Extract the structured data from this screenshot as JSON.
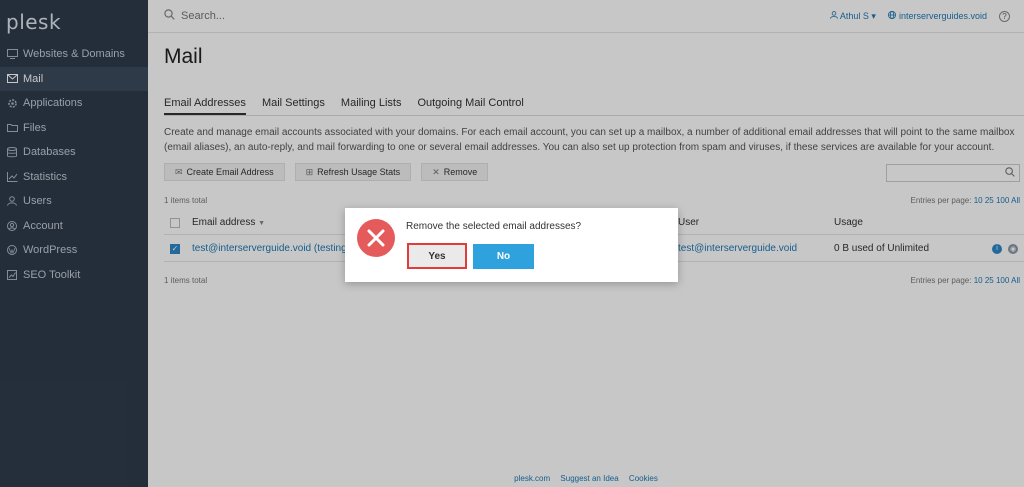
{
  "sidebar": {
    "logo": "plesk",
    "items": [
      {
        "label": "Websites & Domains",
        "icon": "monitor-icon"
      },
      {
        "label": "Mail",
        "icon": "mail-icon"
      },
      {
        "label": "Applications",
        "icon": "gear-icon"
      },
      {
        "label": "Files",
        "icon": "folder-icon"
      },
      {
        "label": "Databases",
        "icon": "database-icon"
      },
      {
        "label": "Statistics",
        "icon": "chart-icon"
      },
      {
        "label": "Users",
        "icon": "user-icon"
      },
      {
        "label": "Account",
        "icon": "account-icon"
      },
      {
        "label": "WordPress",
        "icon": "wordpress-icon"
      },
      {
        "label": "SEO Toolkit",
        "icon": "seo-icon"
      }
    ],
    "active_index": 1
  },
  "header": {
    "search_placeholder": "Search...",
    "user": "Athul S",
    "domain": "interserverguides.void",
    "help": "?"
  },
  "main": {
    "title": "Mail",
    "tabs": [
      "Email Addresses",
      "Mail Settings",
      "Mailing Lists",
      "Outgoing Mail Control"
    ],
    "description": "Create and manage email accounts associated with your domains. For each email account, you can set up a mailbox, a number of additional email addresses that will point to the same mailbox (email aliases), an auto-reply, and mail forwarding to one or several email addresses. You can also set up protection from spam and viruses, if these services are available for your account.",
    "toolbar": {
      "create": "Create Email Address",
      "refresh": "Refresh Usage Stats",
      "remove": "Remove"
    },
    "items_total": "1 items total",
    "entries_label": "Entries per page:",
    "entries_options": [
      "10",
      "25",
      "100",
      "All"
    ],
    "table": {
      "col_email": "Email address",
      "col_user": "User",
      "col_usage": "Usage",
      "sort_indicator": "▼",
      "rows": [
        {
          "email": "test@interserverguide.void (testing",
          "user": "test@interserverguide.void",
          "usage": "0 B used of Unlimited"
        }
      ]
    }
  },
  "footer": {
    "links": [
      "plesk.com",
      "Suggest an Idea",
      "Cookies"
    ]
  },
  "dialog": {
    "message": "Remove the selected email addresses?",
    "yes": "Yes",
    "no": "No",
    "icon": "error-x-icon"
  },
  "colors": {
    "sidebar_bg": "#2f3b4c",
    "link": "#1e78b4",
    "primary_button": "#2fa1dc",
    "error": "#e55b5b",
    "highlight_border": "#e23b3b"
  }
}
